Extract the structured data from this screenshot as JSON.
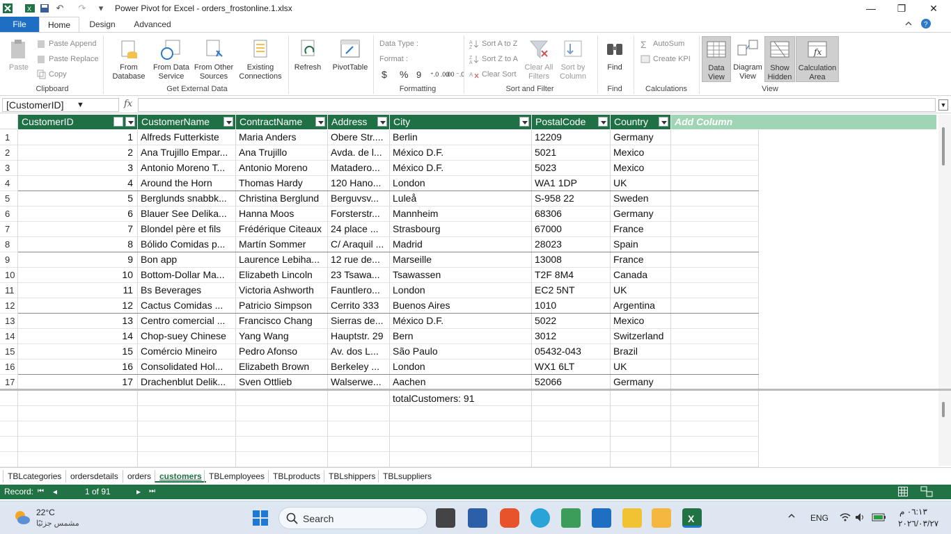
{
  "window": {
    "title": "Power Pivot for Excel - orders_frostonline.1.xlsx",
    "minimize": "—",
    "maximize": "❐",
    "close": "✕"
  },
  "qat": {
    "undo": "↶",
    "redo": "↷",
    "more": "▾"
  },
  "tabs": {
    "file": "File",
    "home": "Home",
    "design": "Design",
    "advanced": "Advanced"
  },
  "ribbon": {
    "clipboard": {
      "label": "Clipboard",
      "paste": "Paste",
      "paste_append": "Paste Append",
      "paste_replace": "Paste Replace",
      "copy": "Copy"
    },
    "external": {
      "label": "Get External Data",
      "from_database": "From Database",
      "from_data_service": "From Data Service",
      "from_other_sources": "From Other Sources",
      "existing_connections": "Existing Connections"
    },
    "refresh": "Refresh",
    "pivottable": "PivotTable",
    "formatting": {
      "label": "Formatting",
      "data_type": "Data Type :",
      "format": "Format :",
      "currency": "$",
      "percent": "%",
      "comma": "9",
      "inc_dec": "⁺.0 .00",
      "dec_dec": ".00 ⁻.0"
    },
    "sortfilter": {
      "label": "Sort and Filter",
      "sort_az": "Sort A to Z",
      "sort_za": "Sort Z to A",
      "clear_sort": "Clear Sort",
      "clear_all_filters": "Clear All Filters",
      "sort_by_column": "Sort by Column"
    },
    "find": {
      "label": "Find",
      "find": "Find"
    },
    "calculations": {
      "label": "Calculations",
      "autosum": "AutoSum",
      "create_kpi": "Create KPI"
    },
    "view": {
      "label": "View",
      "data_view": "Data View",
      "diagram_view": "Diagram View",
      "show_hidden": "Show Hidden",
      "calculation_area": "Calculation Area"
    }
  },
  "formula_bar": {
    "name_box": "[CustomerID]",
    "fx": "fx",
    "formula": ""
  },
  "table": {
    "columns": [
      "CustomerID",
      "CustomerName",
      "ContractName",
      "Address",
      "City",
      "PostalCode",
      "Country"
    ],
    "add_column": "Add Column",
    "rows": [
      [
        "1",
        "1",
        "Alfreds Futterkiste",
        "Maria Anders",
        "Obere Str....",
        "Berlin",
        "12209",
        "Germany"
      ],
      [
        "2",
        "2",
        "Ana Trujillo Empar...",
        "Ana Trujillo",
        "Avda. de l...",
        "México D.F.",
        "5021",
        "Mexico"
      ],
      [
        "3",
        "3",
        "Antonio Moreno T...",
        "Antonio Moreno",
        "Matadero...",
        "México D.F.",
        "5023",
        "Mexico"
      ],
      [
        "4",
        "4",
        "Around the Horn",
        "Thomas Hardy",
        "120 Hano...",
        "London",
        "WA1 1DP",
        "UK"
      ],
      [
        "5",
        "5",
        "Berglunds snabbk...",
        "Christina Berglund",
        "Berguvsv...",
        "Luleå",
        "S-958 22",
        "Sweden"
      ],
      [
        "6",
        "6",
        "Blauer See Delika...",
        "Hanna Moos",
        "Forsterstr...",
        "Mannheim",
        "68306",
        "Germany"
      ],
      [
        "7",
        "7",
        "Blondel père et fils",
        "Frédérique Citeaux",
        "24 place ...",
        "Strasbourg",
        "67000",
        "France"
      ],
      [
        "8",
        "8",
        "Bólido Comidas p...",
        "Martín Sommer",
        "C/ Araquil ...",
        "Madrid",
        "28023",
        "Spain"
      ],
      [
        "9",
        "9",
        "Bon app",
        "Laurence Lebiha...",
        "12 rue de...",
        "Marseille",
        "13008",
        "France"
      ],
      [
        "10",
        "10",
        "Bottom-Dollar Ma...",
        "Elizabeth Lincoln",
        "23 Tsawa...",
        "Tsawassen",
        "T2F 8M4",
        "Canada"
      ],
      [
        "11",
        "11",
        "Bs Beverages",
        "Victoria Ashworth",
        "Fauntlero...",
        "London",
        "EC2 5NT",
        "UK"
      ],
      [
        "12",
        "12",
        "Cactus Comidas ...",
        "Patricio Simpson",
        "Cerrito 333",
        "Buenos Aires",
        "1010",
        "Argentina"
      ],
      [
        "13",
        "13",
        "Centro comercial ...",
        "Francisco Chang",
        "Sierras de...",
        "México D.F.",
        "5022",
        "Mexico"
      ],
      [
        "14",
        "14",
        "Chop-suey Chinese",
        "Yang Wang",
        "Hauptstr. 29",
        "Bern",
        "3012",
        "Switzerland"
      ],
      [
        "15",
        "15",
        "Comércio Mineiro",
        "Pedro Afonso",
        "Av. dos L...",
        "São Paulo",
        "05432-043",
        "Brazil"
      ],
      [
        "16",
        "16",
        "Consolidated Hol...",
        "Elizabeth Brown",
        "Berkeley ...",
        "London",
        "WX1 6LT",
        "UK"
      ],
      [
        "17",
        "17",
        "Drachenblut Delik...",
        "Sven Ottlieb",
        "Walserwe...",
        "Aachen",
        "52066",
        "Germany"
      ]
    ]
  },
  "calc_area": {
    "measure": "totalCustomers: 91"
  },
  "sheets": [
    "TBLcategories",
    "ordersdetails",
    "orders",
    "customers",
    "TBLemployees",
    "TBLproducts",
    "TBLshippers",
    "TBLsuppliers"
  ],
  "active_sheet": "customers",
  "status": {
    "record_label": "Record:",
    "first": "⏮",
    "prev": "◂",
    "position": "1 of 91",
    "next": "▸",
    "last": "⏭"
  },
  "taskbar": {
    "weather_temp": "22°C",
    "weather_desc": "مشمس جزئيًا",
    "search": "Search",
    "lang": "ENG",
    "time": "٠٦:١٣ م",
    "date": "٢٠٢٦/٠٣/٢٧"
  },
  "colors": {
    "header_green": "#1f7145",
    "status_green": "#217346",
    "file_blue": "#1e6fc3",
    "add_col": "#9fd4b4"
  }
}
